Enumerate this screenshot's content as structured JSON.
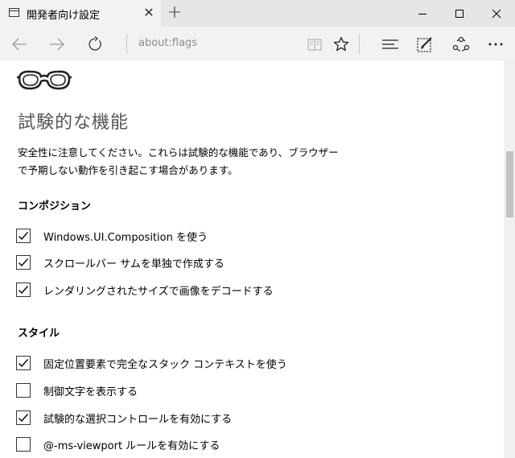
{
  "tab": {
    "title": "開発者向け設定"
  },
  "address": {
    "url": "about:flags"
  },
  "page": {
    "heading": "試験的な機能",
    "description": "安全性に注意してください。これらは試験的な機能であり、ブラウザーで予期しない動作を引き起こす場合があります。",
    "sections": [
      {
        "title": "コンポジション",
        "options": [
          {
            "label": "Windows.UI.Composition を使う",
            "checked": true
          },
          {
            "label": "スクロールバー サムを単独で作成する",
            "checked": true
          },
          {
            "label": "レンダリングされたサイズで画像をデコードする",
            "checked": true
          }
        ]
      },
      {
        "title": "スタイル",
        "options": [
          {
            "label": "固定位置要素で完全なスタック コンテキストを使う",
            "checked": true
          },
          {
            "label": "制御文字を表示する",
            "checked": false
          },
          {
            "label": "試験的な選択コントロールを有効にする",
            "checked": true
          },
          {
            "label": "@-ms-viewport ルールを有効にする",
            "checked": false
          }
        ]
      }
    ]
  }
}
